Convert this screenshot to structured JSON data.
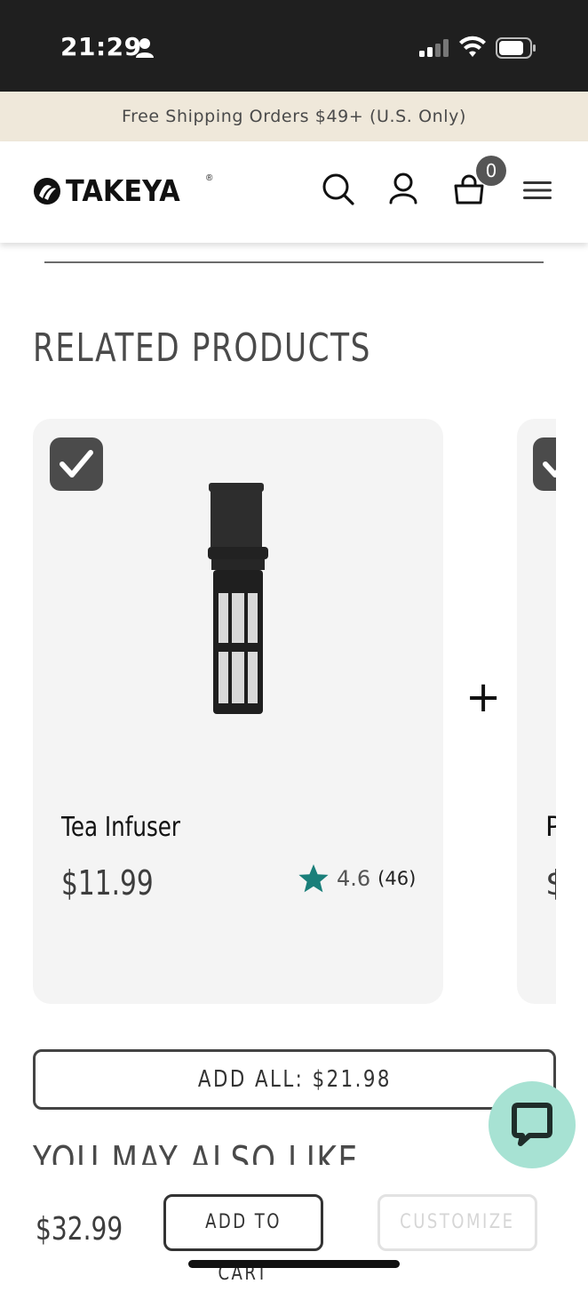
{
  "status_bar": {
    "time": "21:29",
    "icons": [
      "person-icon",
      "signal-icon",
      "wifi-icon",
      "battery-icon"
    ]
  },
  "promo_banner": {
    "text": "Free Shipping Orders $49+ (U.S. Only)"
  },
  "header": {
    "logo_text": "TAKEYA",
    "logo_mark": "®",
    "icons": [
      "search-icon",
      "account-icon",
      "cart-icon",
      "menu-icon"
    ],
    "cart_count": "0"
  },
  "related": {
    "title": "RELATED PRODUCTS",
    "products": [
      {
        "name": "Tea Infuser",
        "price": "$11.99",
        "rating": "4.6",
        "review_count": "(46)",
        "selected": true
      },
      {
        "name": "P",
        "price": "$",
        "selected": true
      }
    ],
    "plus_symbol": "+",
    "add_all_label": "ADD ALL: $21.98"
  },
  "you_may_also_like": {
    "title": "YOU MAY ALSO LIKE"
  },
  "bottom_bar": {
    "price": "$32.99",
    "add_to_cart_label": "ADD TO CART",
    "customize_label": "CUSTOMIZE"
  },
  "colors": {
    "status_bar_bg": "#1f1f1f",
    "promo_bg": "#efe8da",
    "card_bg": "#f4f4f4",
    "star": "#1a7f7a",
    "chat_bubble": "#a7e2d3"
  }
}
